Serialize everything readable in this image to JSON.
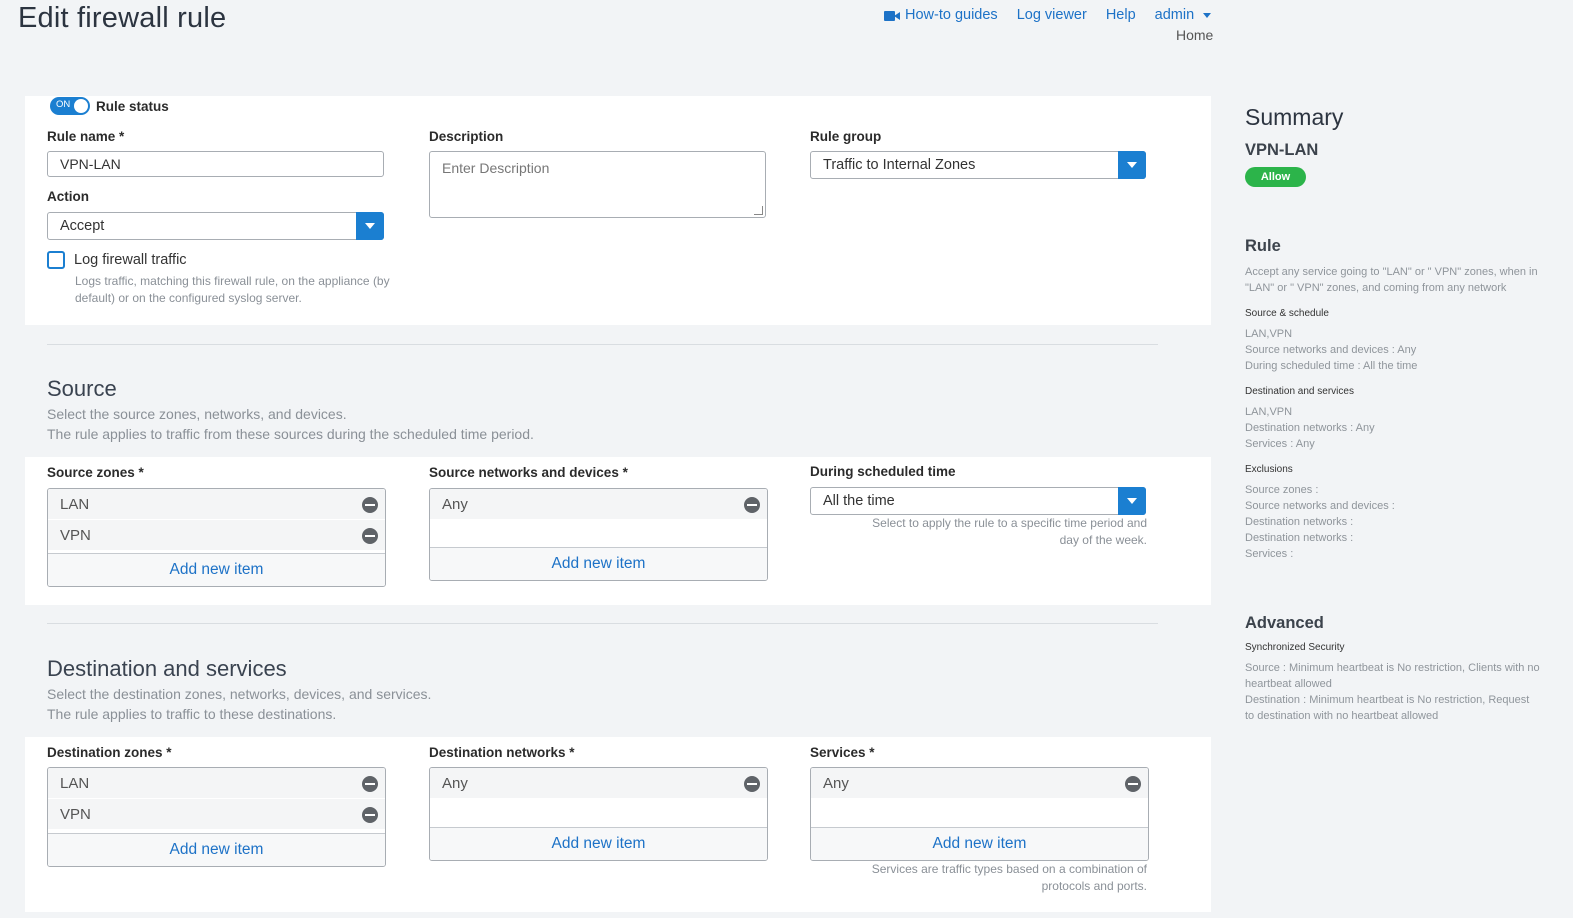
{
  "header": {
    "title": "Edit firewall rule",
    "links": {
      "howto": "How-to guides",
      "log_viewer": "Log viewer",
      "help": "Help",
      "admin": "admin"
    },
    "home": "Home"
  },
  "general": {
    "toggle_text": "ON",
    "rule_status_label": "Rule status",
    "rule_name_label": "Rule name *",
    "rule_name_value": "VPN-LAN",
    "description_label": "Description",
    "description_placeholder": "Enter Description",
    "rule_group_label": "Rule group",
    "rule_group_value": "Traffic to Internal Zones",
    "action_label": "Action",
    "action_value": "Accept",
    "log_label": "Log firewall traffic",
    "log_help_1": "Logs traffic, matching this firewall rule, on the appliance (by",
    "log_help_2": "default) or on the configured syslog server."
  },
  "source": {
    "title": "Source",
    "desc_1": "Select the source zones, networks, and devices.",
    "desc_2": "The rule applies to traffic from these sources during the scheduled time period.",
    "zones_label": "Source zones *",
    "zones": [
      "LAN",
      "VPN"
    ],
    "networks_label": "Source networks and devices *",
    "networks": [
      "Any"
    ],
    "schedule_label": "During scheduled time",
    "schedule_value": "All the time",
    "schedule_help_1": "Select to apply the rule to a specific time period and",
    "schedule_help_2": "day of the week.",
    "add_item": "Add new item"
  },
  "destination": {
    "title": "Destination and services",
    "desc_1": "Select the destination zones, networks, devices, and services.",
    "desc_2": "The rule applies to traffic to these destinations.",
    "zones_label": "Destination zones *",
    "zones": [
      "LAN",
      "VPN"
    ],
    "networks_label": "Destination networks *",
    "networks": [
      "Any"
    ],
    "services_label": "Services *",
    "services": [
      "Any"
    ],
    "services_help_1": "Services are traffic types based on a combination of",
    "services_help_2": "protocols and ports.",
    "add_item": "Add new item"
  },
  "summary": {
    "title": "Summary",
    "name": "VPN-LAN",
    "badge": "Allow",
    "rule_heading": "Rule",
    "rule_text_1": "Accept any service going to \"LAN\" or \" VPN\" zones, when in",
    "rule_text_2": "\"LAN\" or \" VPN\" zones, and coming from any network",
    "src_heading": "Source & schedule",
    "src_lines": [
      "LAN,VPN",
      "Source networks and devices : Any",
      "During scheduled time : All the time"
    ],
    "dst_heading": "Destination and services",
    "dst_lines": [
      "LAN,VPN",
      "Destination networks : Any",
      "Services : Any"
    ],
    "exc_heading": "Exclusions",
    "exc_lines": [
      "Source zones :",
      "Source networks and devices :",
      "Destination networks :",
      "Destination networks :",
      "Services :"
    ],
    "adv_heading": "Advanced",
    "sync_heading": "Synchronized Security",
    "adv_lines": [
      "Source : Minimum heartbeat is No restriction, Clients with no",
      "heartbeat allowed",
      "Destination : Minimum heartbeat is No restriction, Request",
      "to destination with no heartbeat allowed"
    ]
  },
  "colors": {
    "accent": "#1b7fd1",
    "allow": "#2cb44a"
  }
}
